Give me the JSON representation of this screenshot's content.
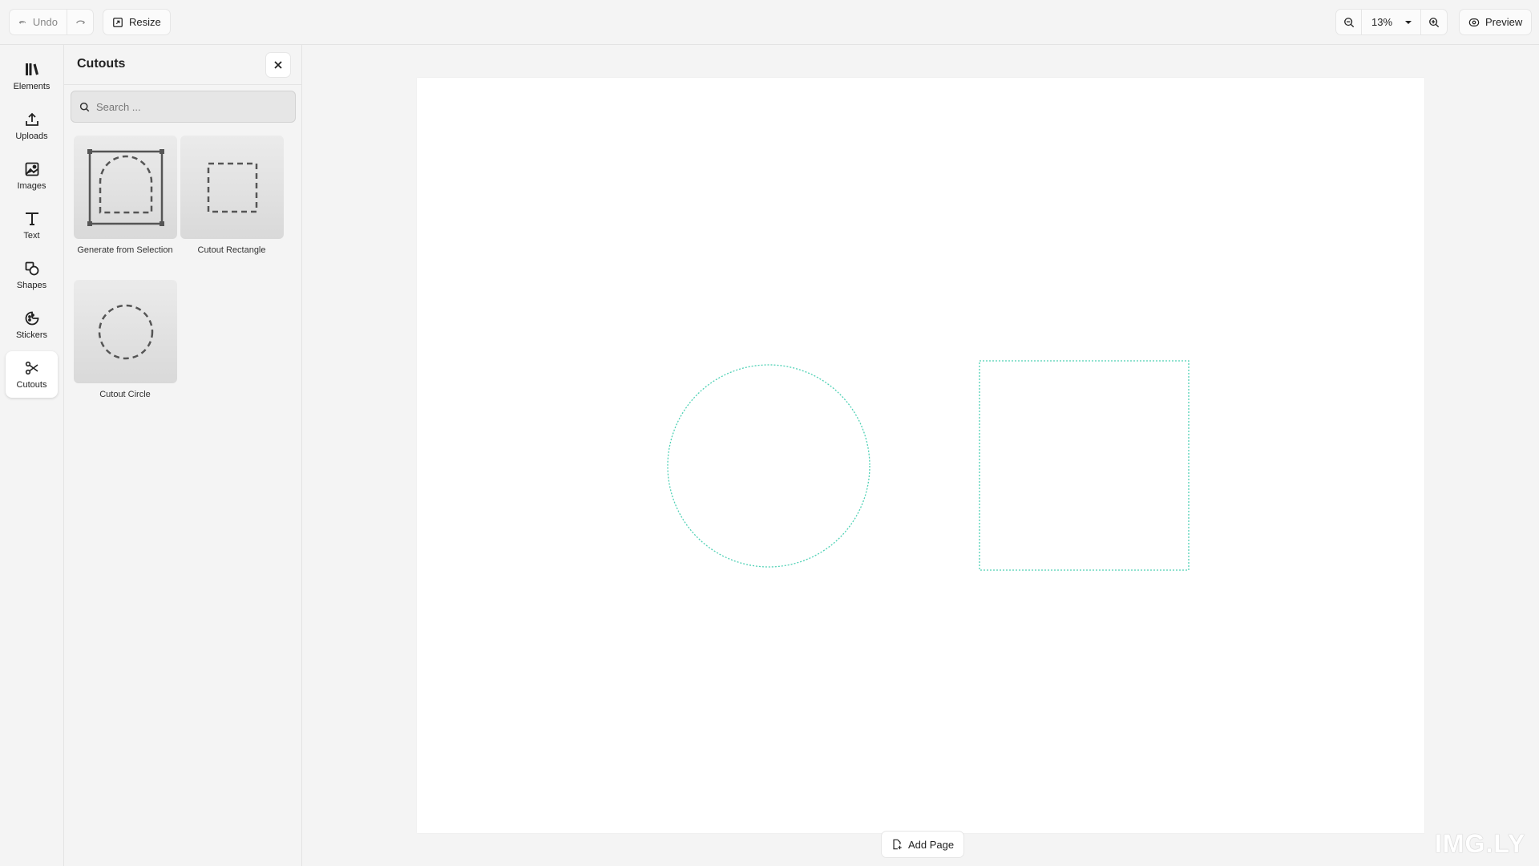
{
  "toolbar": {
    "undo_label": "Undo",
    "resize_label": "Resize",
    "zoom_value": "13%",
    "preview_label": "Preview"
  },
  "rail": {
    "items": [
      {
        "label": "Elements",
        "icon": "library-icon"
      },
      {
        "label": "Uploads",
        "icon": "upload-icon"
      },
      {
        "label": "Images",
        "icon": "image-icon"
      },
      {
        "label": "Text",
        "icon": "text-icon"
      },
      {
        "label": "Shapes",
        "icon": "shapes-icon"
      },
      {
        "label": "Stickers",
        "icon": "sticker-icon"
      },
      {
        "label": "Cutouts",
        "icon": "scissors-icon",
        "active": true
      }
    ]
  },
  "panel": {
    "title": "Cutouts",
    "search_placeholder": "Search ...",
    "tiles": [
      {
        "label": "Generate from Selection"
      },
      {
        "label": "Cutout Rectangle"
      },
      {
        "label": "Cutout Circle"
      }
    ]
  },
  "canvas": {
    "add_page_label": "Add Page",
    "cutout_color": "#4fd1b5"
  },
  "watermark": "IMG.LY"
}
